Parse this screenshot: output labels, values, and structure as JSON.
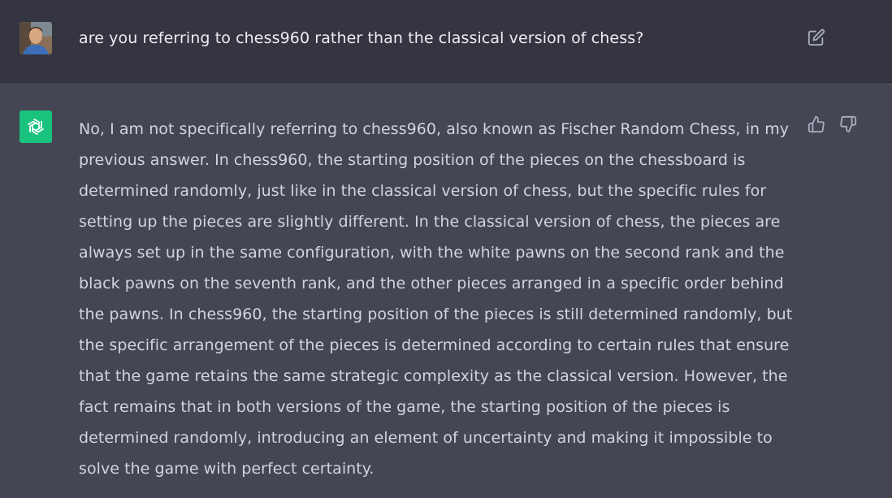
{
  "user_message": {
    "text": "are you referring to chess960 rather than the classical version of chess?",
    "avatar_icon": "user-avatar-photo",
    "edit_icon": "edit-icon"
  },
  "assistant_message": {
    "text": "No, I am not specifically referring to chess960, also known as Fischer Random Chess, in my previous answer. In chess960, the starting position of the pieces on the chessboard is determined randomly, just like in the classical version of chess, but the specific rules for setting up the pieces are slightly different. In the classical version of chess, the pieces are always set up in the same configuration, with the white pawns on the second rank and the black pawns on the seventh rank, and the other pieces arranged in a specific order behind the pawns. In chess960, the starting position of the pieces is still determined randomly, but the specific arrangement of the pieces is determined according to certain rules that ensure that the game retains the same strategic complexity as the classical version. However, the fact remains that in both versions of the game, the starting position of the pieces is determined randomly, introducing an element of uncertainty and making it impossible to solve the game with perfect certainty.",
    "avatar_icon": "openai-logo-icon",
    "thumbs_up_icon": "thumbs-up-icon",
    "thumbs_down_icon": "thumbs-down-icon"
  },
  "colors": {
    "user_bg": "#343541",
    "assistant_bg": "#444654",
    "bot_avatar": "#19c37d",
    "text": "#d1d5db",
    "icon": "#acacbe"
  }
}
